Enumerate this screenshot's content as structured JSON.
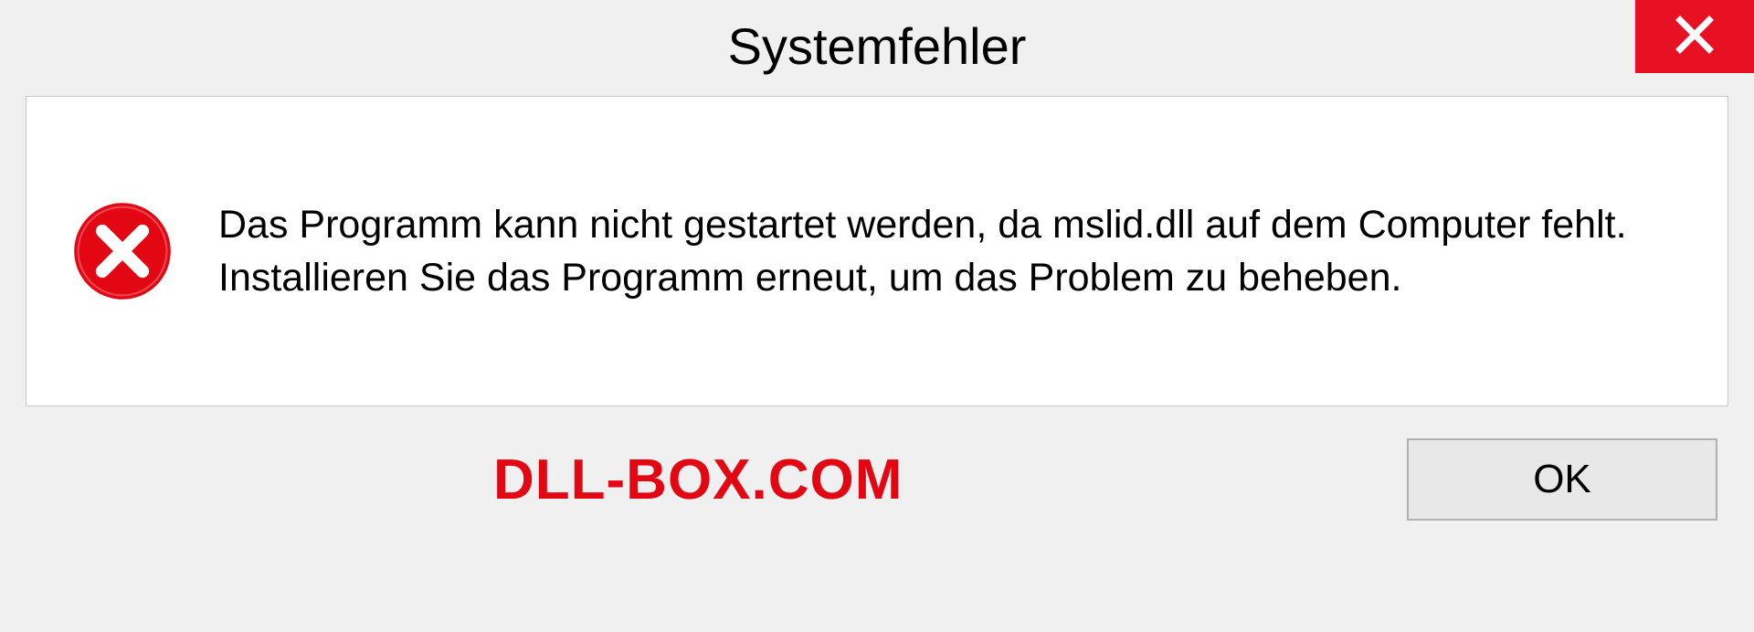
{
  "dialog": {
    "title": "Systemfehler",
    "message": "Das Programm kann nicht gestartet werden, da mslid.dll auf dem Computer fehlt. Installieren Sie das Programm erneut, um das Problem zu beheben.",
    "ok_label": "OK"
  },
  "watermark": {
    "text": "DLL-BOX.COM"
  },
  "colors": {
    "close_red": "#e81123",
    "error_red": "#e30613",
    "watermark_red": "#e30613"
  }
}
